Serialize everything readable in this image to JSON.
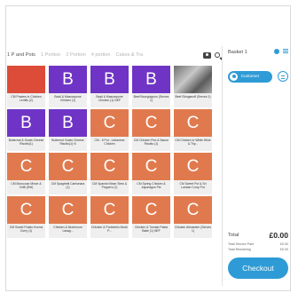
{
  "tabs": [
    "1 P and Pots",
    "1 Portion",
    "2 Portion",
    "4 portion",
    "Cakes & Tra"
  ],
  "tiles": [
    {
      "letter": "",
      "color": "red",
      "label": "CM Prawns in Chicken Lentils (2)"
    },
    {
      "letter": "B",
      "color": "purple",
      "label": "Basil & Mascarpone Chicken (1)"
    },
    {
      "letter": "B",
      "color": "purple",
      "label": "Basil & Mascarpone Chicken (1) NEF"
    },
    {
      "letter": "B",
      "color": "purple",
      "label": "Beef Bourguignon (Serves 1)"
    },
    {
      "letter": "",
      "color": "photo",
      "label": "Beef Stroganoff (Serves 1)"
    },
    {
      "letter": "B",
      "color": "purple",
      "label": "Butternut & Goats Cheese Risotto(1)"
    },
    {
      "letter": "B",
      "color": "purple",
      "label": "Butternut Goats Cheese Risotto(1) N"
    },
    {
      "letter": "C",
      "color": "orange",
      "label": "CM - 5 Pot - Lebanese Chicken"
    },
    {
      "letter": "C",
      "color": "orange",
      "label": "CM Chicken Pea & Bacon Risotto (1)"
    },
    {
      "letter": "C",
      "color": "orange",
      "label": "CM Chicken in White Wine & Thy..."
    },
    {
      "letter": "C",
      "color": "orange",
      "label": "CM Moroccan Mince & Chilli (Ref)"
    },
    {
      "letter": "C",
      "color": "orange",
      "label": "CM Spaghetti Carbonara (1)"
    },
    {
      "letter": "C",
      "color": "orange",
      "label": "CM Spanish Bean Stew & Peppers (1)"
    },
    {
      "letter": "C",
      "color": "orange",
      "label": "CM Spring Chicken & Asparagus Pie"
    },
    {
      "letter": "C",
      "color": "orange",
      "label": "CM Sweet Pot & Sri Lankan Curry Pot"
    },
    {
      "letter": "C",
      "color": "orange",
      "label": "CM Sweet Potato Korma Curry (1)"
    },
    {
      "letter": "C",
      "color": "orange",
      "label": "Chicken & Mushroom Lasag..."
    },
    {
      "letter": "C",
      "color": "orange",
      "label": "Chicken & Portobello Mush P..."
    },
    {
      "letter": "C",
      "color": "orange",
      "label": "Chicken & Tomato Pasta Bake (1) NEF"
    },
    {
      "letter": "C",
      "color": "orange",
      "label": "Chicken Alexander (Serves 1)"
    }
  ],
  "basket": {
    "title": "Basket 1",
    "customer_label": "Customer",
    "total_label": "Total",
    "total_value": "£0.00",
    "service_label": "Total Service Paid",
    "service_value": "£0.00",
    "remaining_label": "Total Remaining",
    "remaining_value": "£0.00",
    "checkout_label": "Checkout"
  },
  "colors": {
    "accent": "#2e9bd6",
    "red": "#dd4b39",
    "purple": "#6f34c5",
    "orange": "#e07a4e"
  }
}
